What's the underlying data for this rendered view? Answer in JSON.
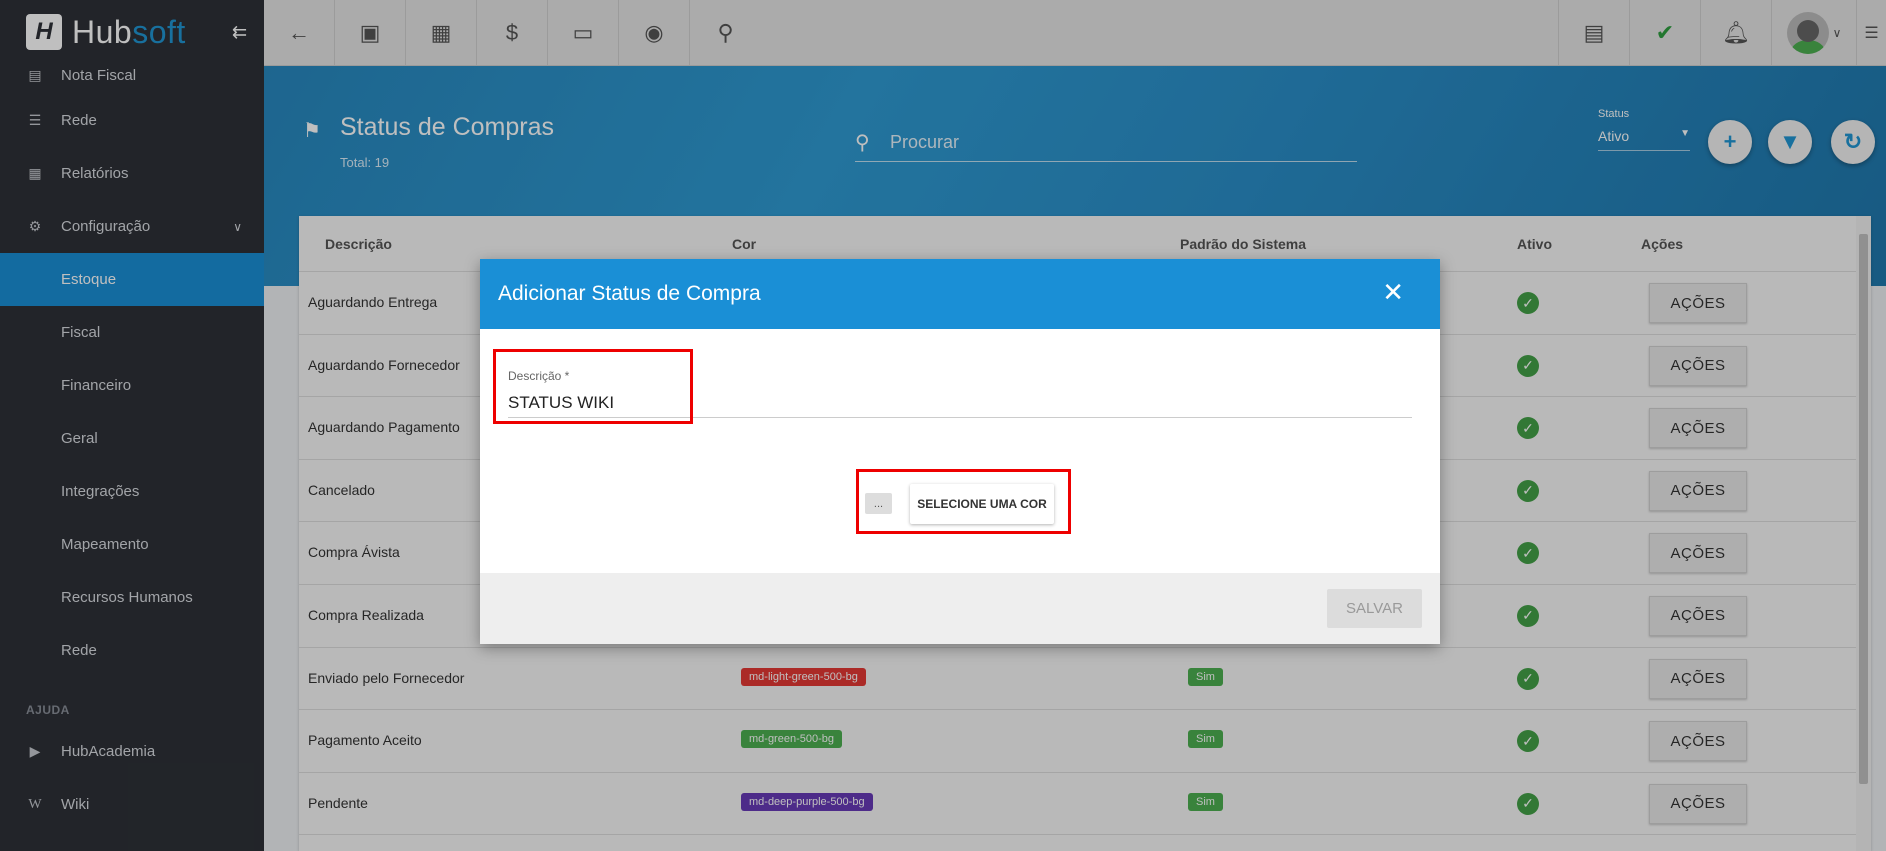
{
  "sidebar": {
    "brand_first": "Hub",
    "brand_second": "soft",
    "brand_mark": "H",
    "items": [
      {
        "label": "Nota Fiscal",
        "icon": "document-icon"
      },
      {
        "label": "Rede",
        "icon": "network-icon"
      },
      {
        "label": "Relatórios",
        "icon": "report-icon"
      },
      {
        "label": "Configuração",
        "icon": "gear-icon"
      },
      {
        "label": "Estoque"
      },
      {
        "label": "Fiscal"
      },
      {
        "label": "Financeiro"
      },
      {
        "label": "Geral"
      },
      {
        "label": "Integrações"
      },
      {
        "label": "Mapeamento"
      },
      {
        "label": "Recursos Humanos"
      },
      {
        "label": "Rede"
      }
    ],
    "section_help": "AJUDA",
    "help_items": [
      {
        "label": "HubAcademia",
        "icon": "youtube-icon"
      },
      {
        "label": "Wiki",
        "icon": "wiki-icon"
      }
    ]
  },
  "header": {
    "title": "Status de Compras",
    "total": "Total: 19",
    "search_placeholder": "Procurar",
    "status_label": "Status",
    "status_value": "Ativo"
  },
  "table": {
    "columns": [
      "Descrição",
      "Cor",
      "Padrão do Sistema",
      "Ativo",
      "Ações"
    ],
    "rows": [
      {
        "descricao": "Aguardando Entrega",
        "acoes": "AÇÕES"
      },
      {
        "descricao": "Aguardando Fornecedor",
        "acoes": "AÇÕES"
      },
      {
        "descricao": "Aguardando Pagamento",
        "acoes": "AÇÕES"
      },
      {
        "descricao": "Cancelado",
        "acoes": "AÇÕES"
      },
      {
        "descricao": "Compra Ávista",
        "acoes": "AÇÕES"
      },
      {
        "descricao": "Compra Realizada",
        "acoes": "AÇÕES"
      },
      {
        "descricao": "Enviado pelo Fornecedor",
        "cor": "md-light-green-500-bg",
        "cor_hex": "#e53935",
        "padrao": "Sim",
        "acoes": "AÇÕES"
      },
      {
        "descricao": "Pagamento Aceito",
        "cor": "md-green-500-bg",
        "cor_hex": "#4caf50",
        "padrao": "Sim",
        "acoes": "AÇÕES"
      },
      {
        "descricao": "Pendente",
        "cor": "md-deep-purple-500-bg",
        "cor_hex": "#673ab7",
        "padrao": "Sim",
        "acoes": "AÇÕES"
      }
    ]
  },
  "modal": {
    "title": "Adicionar Status de Compra",
    "field_label": "Descrição *",
    "field_value": "STATUS WIKI",
    "swatch_text": "...",
    "color_button": "SELECIONE UMA COR",
    "save_button": "SALVAR"
  },
  "colors": {
    "accent": "#1a8fd6",
    "sidebar_bg": "#2e3137",
    "highlight": "#ee0000"
  }
}
